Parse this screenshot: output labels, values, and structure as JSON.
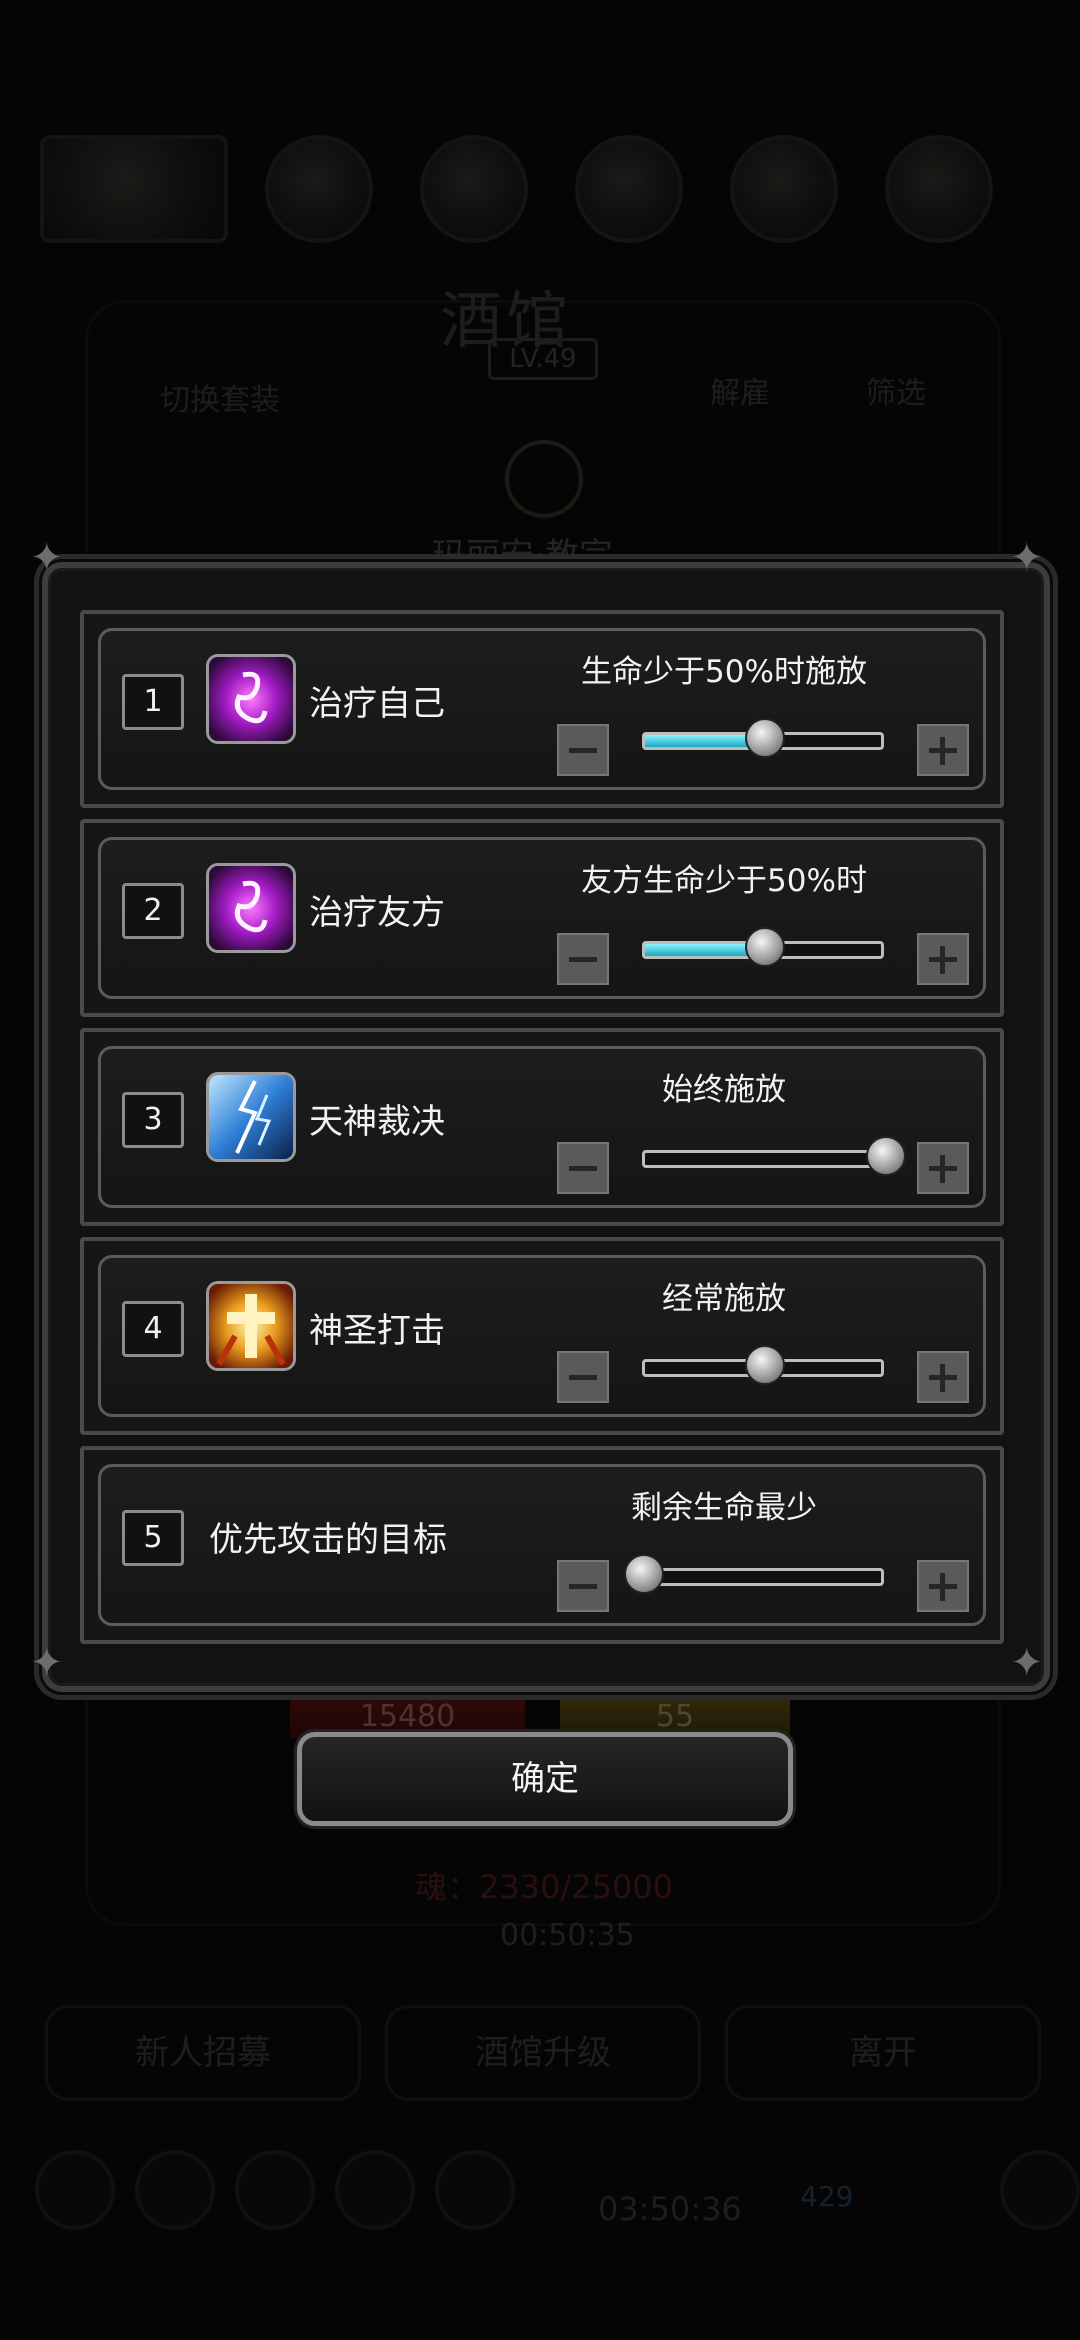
{
  "background": {
    "hall_title": "酒馆",
    "hall_level": "LV.49",
    "tab_switch_set": "切换套装",
    "tab_release": "解雇",
    "tab_filter": "筛选",
    "hero_name": "玛丽安·教宗",
    "hp_value": "15480",
    "mp_value": "55",
    "soul_text": "魂：2330/25000",
    "timer_text": "00:50:35",
    "recruit_label": "新人招募",
    "upgrade_label": "酒馆升级",
    "leave_label": "离开",
    "bottom_clock": "03:50:36",
    "coin_count": "429"
  },
  "modal": {
    "rows": [
      {
        "index": "1",
        "icon": "heal-self-icon",
        "name": "治疗自己",
        "condition": "生命少于50%时施放",
        "level": 0.5
      },
      {
        "index": "2",
        "icon": "heal-ally-icon",
        "name": "治疗友方",
        "condition": "友方生命少于50%时",
        "level": 0.5
      },
      {
        "index": "3",
        "icon": "divine-judgment-icon",
        "name": "天神裁决",
        "condition": "始终施放",
        "level": 1.0
      },
      {
        "index": "4",
        "icon": "holy-strike-icon",
        "name": "神圣打击",
        "condition": "经常施放",
        "level": 0.5
      },
      {
        "index": "5",
        "icon": "",
        "name": "优先攻击的目标",
        "condition": "剩余生命最少",
        "level": 0.0
      }
    ],
    "confirm_label": "确定"
  },
  "colors": {
    "slider_fill": "#1aa9c0",
    "panel_border": "#4a4a4a"
  }
}
